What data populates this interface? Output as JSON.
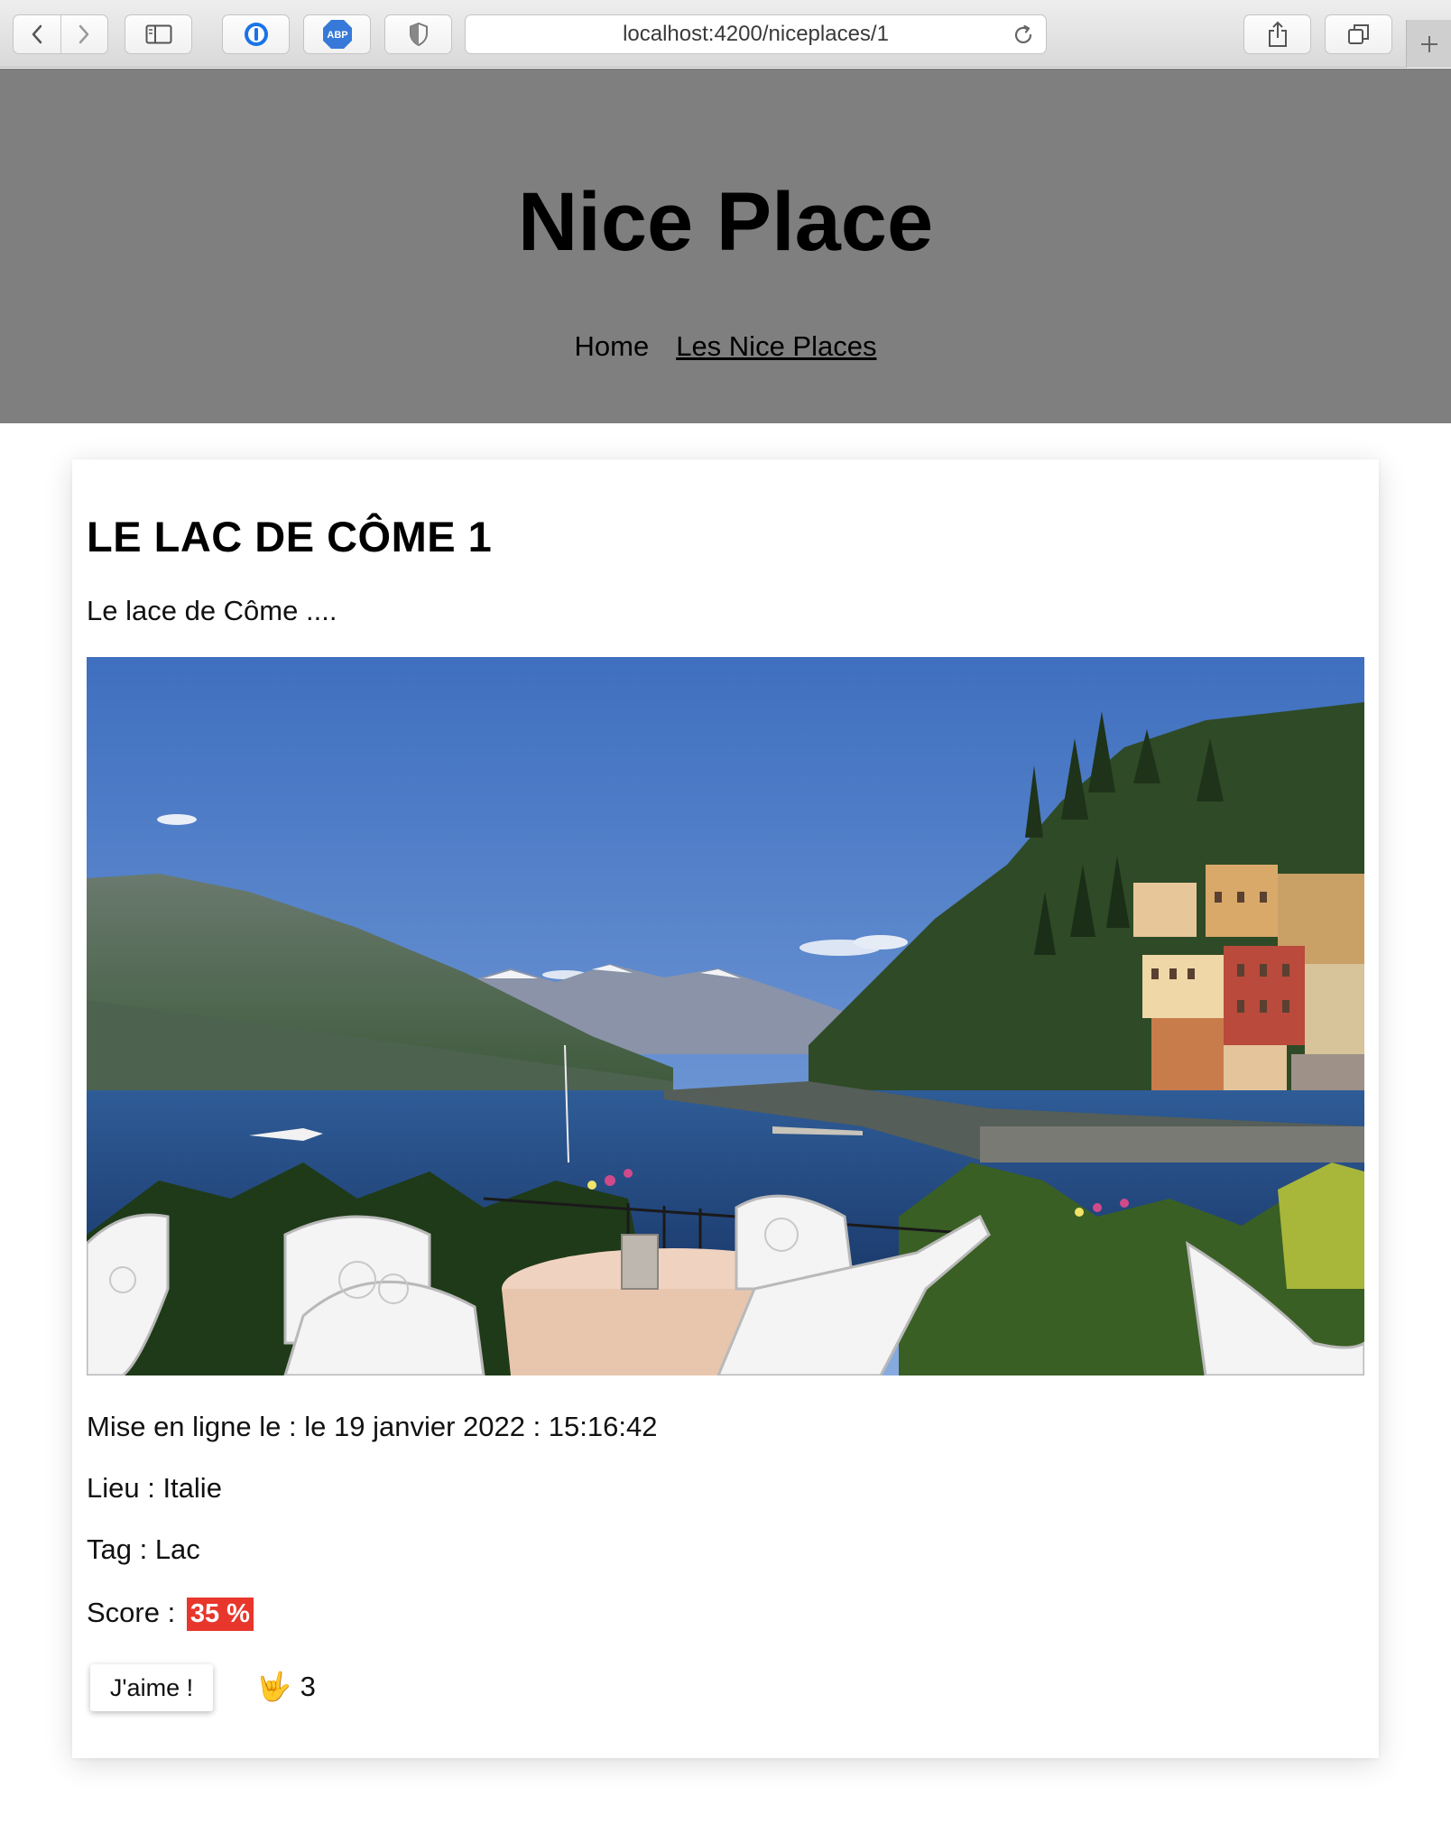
{
  "browser": {
    "url": "localhost:4200/niceplaces/1",
    "extension_badge": "ABP"
  },
  "header": {
    "title": "Nice Place",
    "nav": [
      {
        "label": "Home",
        "active": false
      },
      {
        "label": "Les Nice Places",
        "active": true
      }
    ]
  },
  "place": {
    "title": "Le Lac de Côme 1",
    "description": "Le lace de Côme ....",
    "published": "Mise en ligne le : le 19 janvier 2022 : 15:16:42",
    "location": "Lieu : Italie",
    "tag": "Tag : Lac",
    "score_label": "Score :",
    "score_value": "35 %",
    "score_color": "#e8362c",
    "like_button": "J'aime !",
    "like_emoji": "🤟",
    "like_count": "3"
  }
}
